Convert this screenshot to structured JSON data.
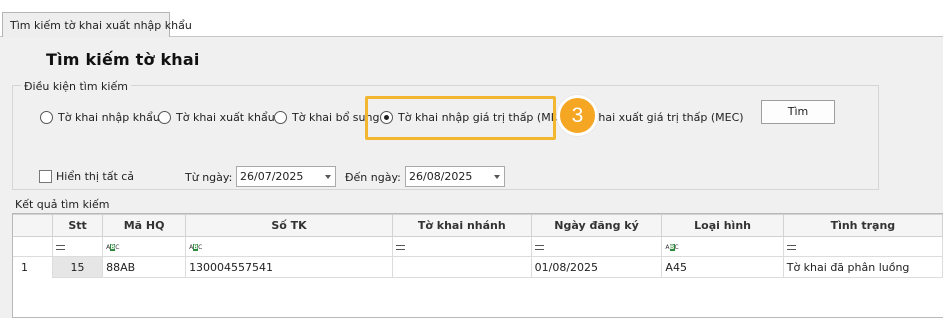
{
  "tabs": [
    {
      "label": "Tìm kiếm tờ khai xuất nhập khẩu"
    }
  ],
  "page_title": "Tìm kiếm tờ khai",
  "search_conditions": {
    "legend": "Điều kiện tìm kiếm",
    "radios": [
      {
        "label": "Tờ khai nhập khẩu",
        "selected": false
      },
      {
        "label": "Tờ khai xuất khẩu",
        "selected": false
      },
      {
        "label": "Tờ khai bổ sung",
        "selected": false
      },
      {
        "label": "Tờ khai nhập giá trị thấp (MIC)",
        "selected": true
      },
      {
        "label": "khai xuất giá trị thấp (MEC)",
        "selected": false
      }
    ],
    "search_button": "Tìm",
    "show_all_label": "Hiển thị tất cả",
    "from_date_label": "Từ ngày:",
    "from_date_value": "26/07/2025",
    "to_date_label": "Đến ngày:",
    "to_date_value": "26/08/2025"
  },
  "step_badge": "3",
  "highlight_color": "#f2b630",
  "badge_color": "#f5a623",
  "results": {
    "legend": "Kết quả tìm kiếm",
    "columns": [
      "Stt",
      "Mã HQ",
      "Số TK",
      "Tờ khai nhánh",
      "Ngày đăng ký",
      "Loại hình",
      "Tình trạng"
    ],
    "filter_icons": [
      "equals-icon",
      "abc-text-icon",
      "abc-text-icon",
      "equals-icon",
      "equals-icon",
      "abc-text-icon",
      "equals-icon"
    ],
    "rows": [
      {
        "row_number": "1",
        "stt": "15",
        "ma_hq": "88AB",
        "so_tk": "130004557541",
        "to_khai_nhanh": "",
        "ngay_dang_ky": "01/08/2025",
        "loai_hinh": "A45",
        "tinh_trang": "Tờ khai đã phân luồng"
      }
    ]
  }
}
